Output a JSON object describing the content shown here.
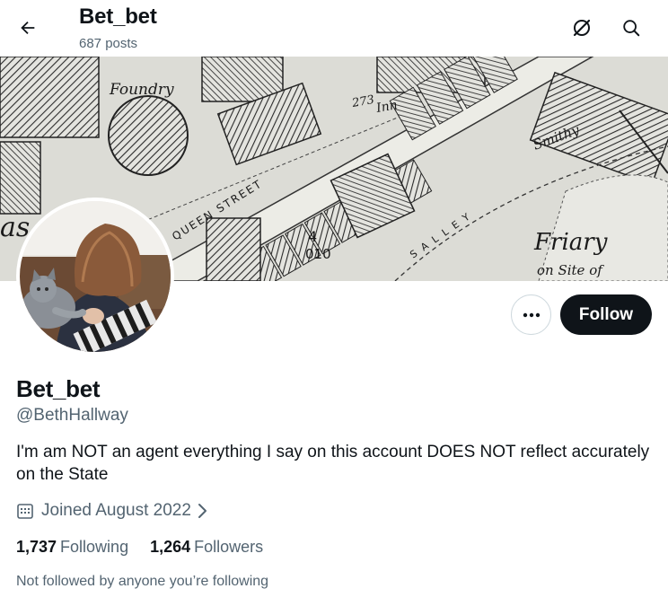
{
  "header": {
    "title": "Bet_bet",
    "post_count": "687 posts",
    "back_icon": "arrow-left-icon",
    "grok_icon": "grok-icon",
    "search_icon": "search-icon"
  },
  "banner": {
    "map_labels": {
      "foundry": "Foundry",
      "inn": "Inn",
      "number_273": "273",
      "smithy": "Smithy",
      "queen_street": "QUEEN  STREET",
      "plot_number": "4",
      "plot_ref": "010",
      "alley": "S   A   L   L   E   Y",
      "friary": "Friary",
      "on_site_of": "on Site of",
      "as": "as"
    }
  },
  "profile": {
    "display_name": "Bet_bet",
    "handle": "@BethHallway",
    "bio": "I'm am NOT an agent everything I say on this account DOES NOT reflect accurately on the State",
    "joined": "Joined August 2022",
    "following_count": "1,737",
    "following_label": "Following",
    "followers_count": "1,264",
    "followers_label": "Followers",
    "mutuals_text": "Not followed by anyone you’re following"
  },
  "actions": {
    "follow_label": "Follow",
    "more_icon": "more-icon"
  },
  "colors": {
    "text_primary": "#0f1419",
    "text_secondary": "#536471",
    "button_dark": "#0f1419",
    "border": "#cfd9de"
  }
}
